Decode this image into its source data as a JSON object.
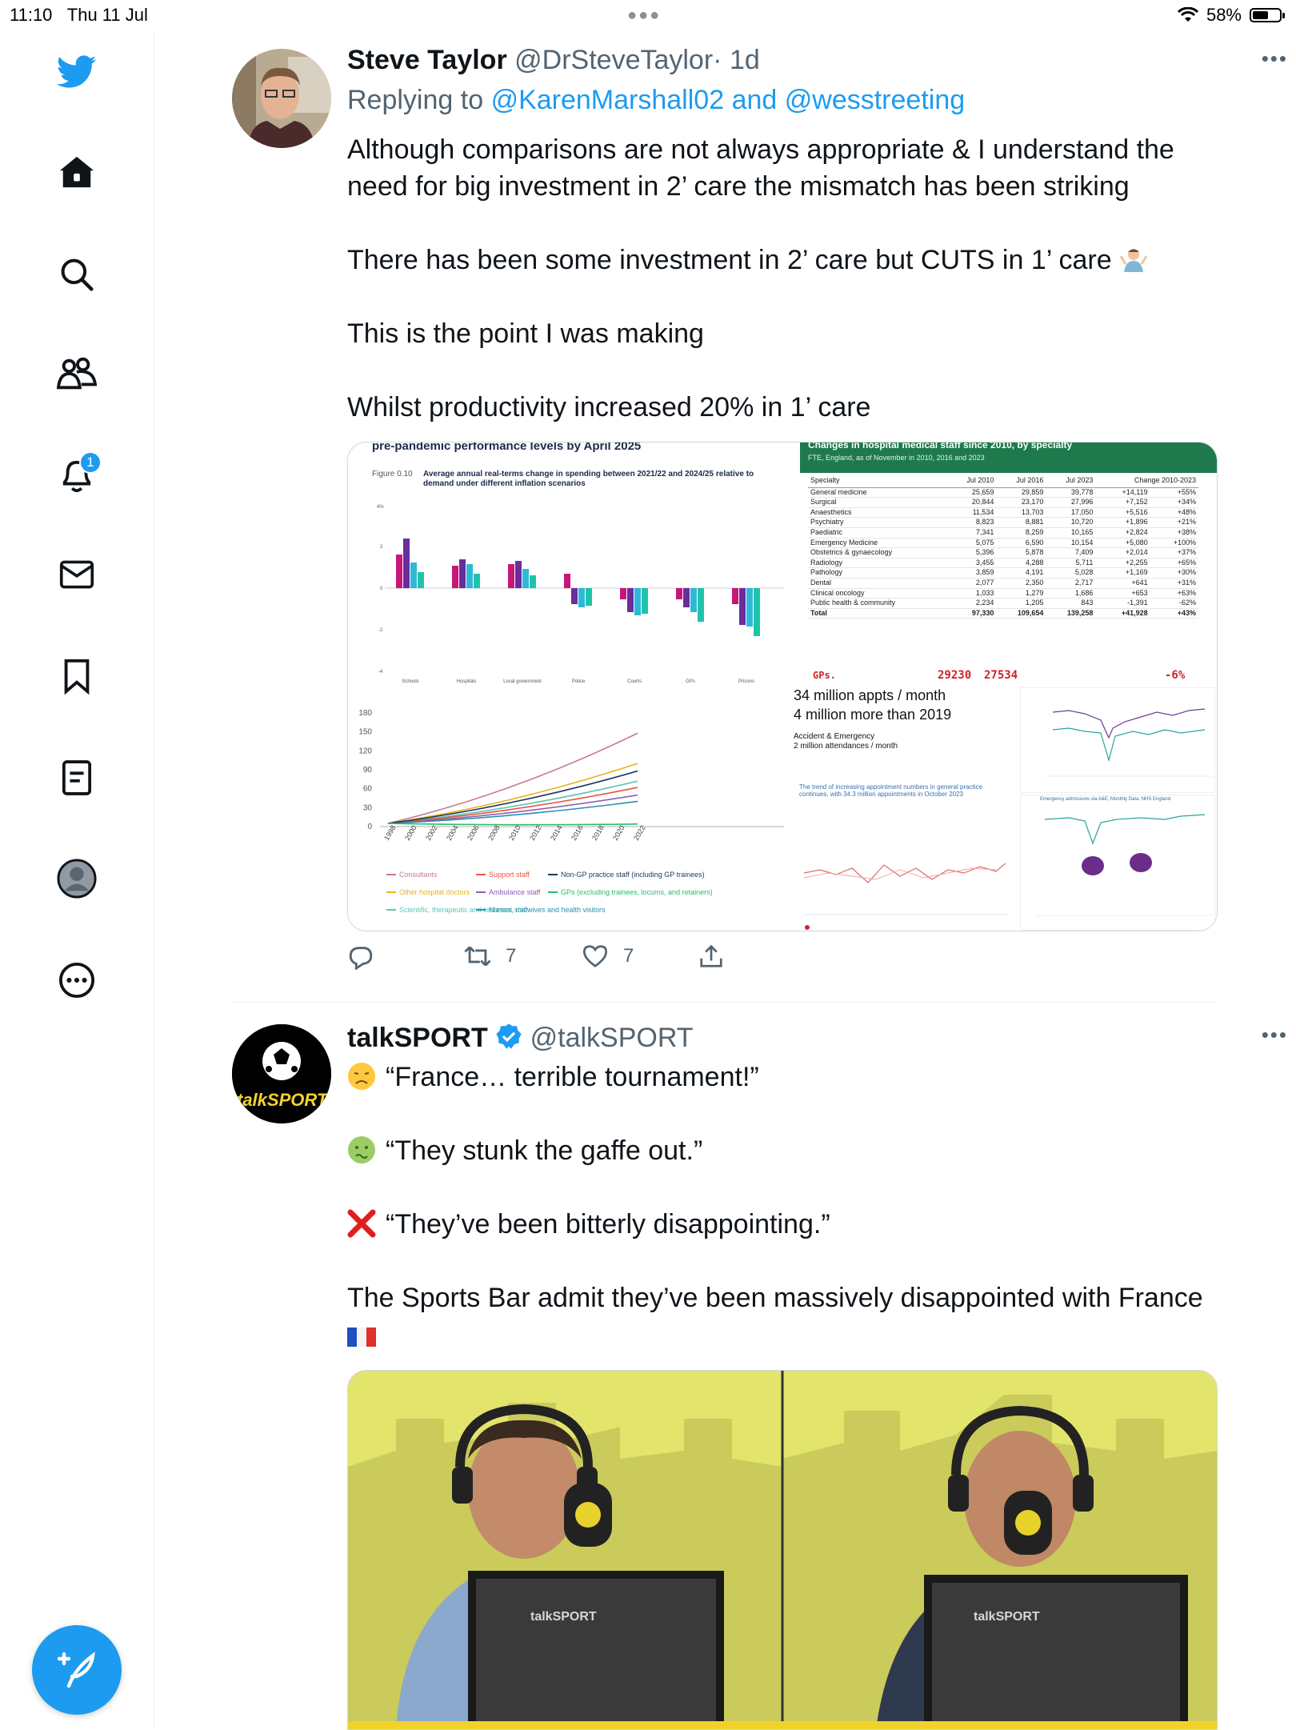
{
  "status_bar": {
    "time": "11:10",
    "date": "Thu 11 Jul",
    "battery": "58%",
    "battery_level": 0.58
  },
  "sidebar": {
    "notifications_badge": "1",
    "items": [
      "twitter-logo",
      "home",
      "explore",
      "communities",
      "notifications",
      "messages",
      "bookmarks",
      "lists",
      "profile",
      "more"
    ]
  },
  "tweet1": {
    "name": "Steve Taylor",
    "handle": "@DrSteveTaylor",
    "time": "· 1d",
    "replying_label": "Replying to",
    "reply_user1": "@KarenMarshall02",
    "reply_and": "and",
    "reply_user2": "@wesstreeting",
    "paragraphs": [
      "Although comparisons are not always appropriate & I understand the need for big investment in 2’ care the mismatch has been striking",
      "There has been some investment in 2’ care but CUTS in 1’ care",
      "This is the point I was making",
      "Whilst productivity increased 20%  in 1’ care"
    ],
    "retweets": "7",
    "likes": "7",
    "media": {
      "bar_title": "pre-pandemic performance levels by April 2025",
      "bar_caption_label": "Figure 0.10",
      "bar_caption": "Average annual real-terms change in spending between 2021/22 and 2024/25 relative to demand under different inflation scenarios",
      "bar_ytick_top": "4%",
      "bar_ytick_2": "2",
      "bar_ytick_0": "0",
      "bar_ytick_m2": "-2",
      "bar_ytick_m4": "-4",
      "bar_cats": [
        "Schools",
        "Hospitals",
        "Local government",
        "Police",
        "Courts",
        "GPs",
        "Prisons"
      ],
      "line_yticks": [
        "180",
        "150",
        "120",
        "90",
        "60",
        "30",
        "0"
      ],
      "line_xticks": [
        "1998",
        "2000",
        "2002",
        "2004",
        "2006",
        "2008",
        "2010",
        "2012",
        "2014",
        "2016",
        "2018",
        "2020",
        "2022"
      ],
      "legend": [
        {
          "label": "Consultants",
          "color": "#c57a8e"
        },
        {
          "label": "Other hospital doctors",
          "color": "#e8b21a"
        },
        {
          "label": "Scientific, therapeutic and technical staff",
          "color": "#5ec4b6"
        },
        {
          "label": "Support staff",
          "color": "#e8533f"
        },
        {
          "label": "Ambulance staff",
          "color": "#8e5fb0"
        },
        {
          "label": "Nurses, midwives and health visitors",
          "color": "#2a8fb0"
        },
        {
          "label": "Non-GP practice staff (including GP trainees)",
          "color": "#1e3a5f"
        },
        {
          "label": "GPs (excluding trainees, locums, and retainers)",
          "color": "#2eb872"
        }
      ],
      "table_title": "Changes in hospital medical staff since 2010, by specialty",
      "table_subtitle": "FTE, England, as of November in 2010, 2016 and 2023",
      "table_headers": [
        "Specialty",
        "Jul 2010",
        "Jul 2016",
        "Jul 2023",
        "Change 2010-2023"
      ],
      "table_rows": [
        [
          "General medicine",
          "25,659",
          "29,859",
          "39,778",
          "+14,119",
          "+55%"
        ],
        [
          "Surgical",
          "20,844",
          "23,170",
          "27,996",
          "+7,152",
          "+34%"
        ],
        [
          "Anaesthetics",
          "11,534",
          "13,703",
          "17,050",
          "+5,516",
          "+48%"
        ],
        [
          "Psychiatry",
          "8,823",
          "8,881",
          "10,720",
          "+1,896",
          "+21%"
        ],
        [
          "Paediatric",
          "7,341",
          "8,259",
          "10,165",
          "+2,824",
          "+38%"
        ],
        [
          "Emergency Medicine",
          "5,075",
          "6,590",
          "10,154",
          "+5,080",
          "+100%"
        ],
        [
          "Obstetrics & gynaecology",
          "5,396",
          "5,878",
          "7,409",
          "+2,014",
          "+37%"
        ],
        [
          "Radiology",
          "3,455",
          "4,288",
          "5,711",
          "+2,255",
          "+65%"
        ],
        [
          "Pathology",
          "3,859",
          "4,191",
          "5,028",
          "+1,169",
          "+30%"
        ],
        [
          "Dental",
          "2,077",
          "2,350",
          "2,717",
          "+641",
          "+31%"
        ],
        [
          "Clinical oncology",
          "1,033",
          "1,279",
          "1,686",
          "+653",
          "+63%"
        ],
        [
          "Public health & community",
          "2,234",
          "1,205",
          "843",
          "-1,391",
          "-62%"
        ],
        [
          "Total",
          "97,330",
          "109,654",
          "139,258",
          "+41,928",
          "+43%"
        ]
      ],
      "hand_gps": "GPs.",
      "hand_v1": "29230",
      "hand_v2": "27534",
      "hand_change": "-6%",
      "appts_line1": "34 million appts / month",
      "appts_line2": "4 million more than 2019",
      "ae_line1": "Accident & Emergency",
      "ae_line2": "2 million attendances / month",
      "trend_caption": "The trend of increasing appointment numbers in general practice continues, with 34.3 million appointments in October 2023",
      "emergency_caption": "Emergency admissions via A&E, Monthly Data, NHS England"
    }
  },
  "tweet2": {
    "name": "talkSPORT",
    "handle": "@talkSPORT",
    "avatar_text": "talkSPORT",
    "lines": [
      "“France… terrible tournament!”",
      "“They stunk the gaffe out.”",
      "“They’ve been bitterly disappointing.”",
      "The Sports Bar admit they’ve been massively disappointed with France"
    ],
    "monitor_brand": "talkSPORT"
  }
}
